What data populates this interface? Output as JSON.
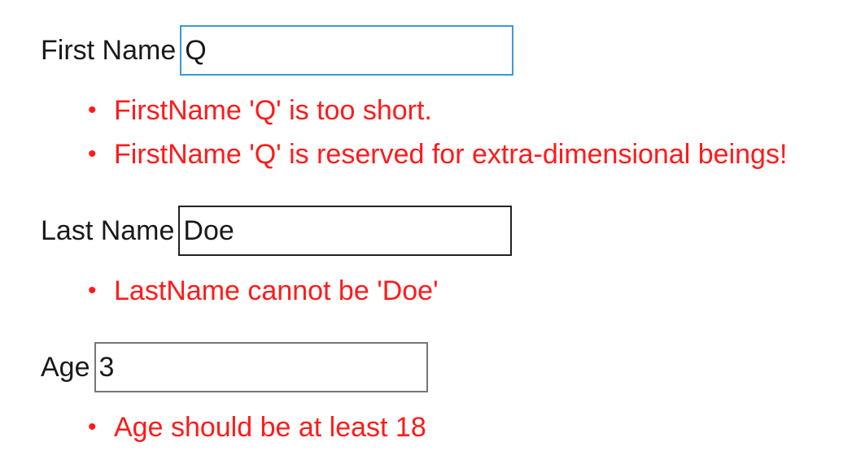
{
  "form": {
    "first_name": {
      "label": "First Name",
      "value": "Q",
      "errors": [
        "FirstName 'Q' is too short.",
        "FirstName 'Q' is reserved for extra-dimensional beings!"
      ]
    },
    "last_name": {
      "label": "Last Name",
      "value": "Doe",
      "errors": [
        "LastName cannot be 'Doe'"
      ]
    },
    "age": {
      "label": "Age",
      "value": "3",
      "errors": [
        "Age should be at least 18"
      ]
    }
  },
  "colors": {
    "error_text": "#ff1a1a",
    "focus_border": "#3a9ad9",
    "label_text": "#1a1a1a"
  }
}
